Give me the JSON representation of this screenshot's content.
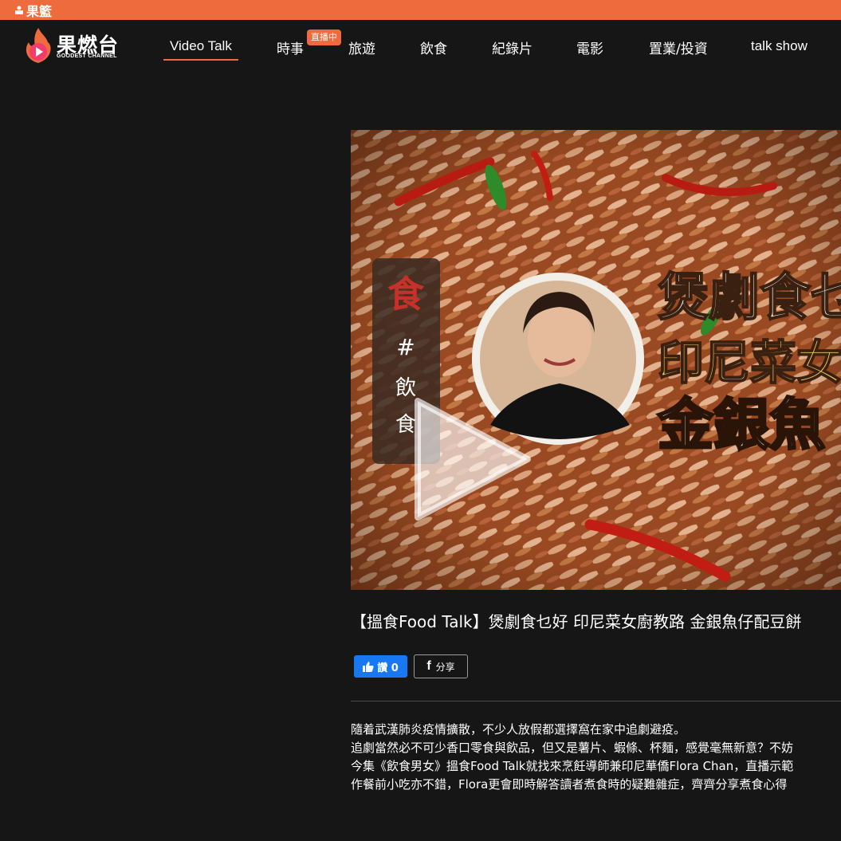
{
  "topbar": {
    "logo_text": "果籃"
  },
  "brand": {
    "name": "果燃台",
    "subtitle": "GOODEST CHANNEL"
  },
  "nav": {
    "items": [
      {
        "label": "Video Talk",
        "active": true
      },
      {
        "label": "時事"
      },
      {
        "label": "旅遊"
      },
      {
        "label": "飲食"
      },
      {
        "label": "紀錄片"
      },
      {
        "label": "電影"
      },
      {
        "label": "置業/投資"
      },
      {
        "label": "talk show"
      }
    ],
    "live_badge": "直播中"
  },
  "video": {
    "side_tag": {
      "icon_char": "食",
      "hash": "#",
      "line1": "飲",
      "line2": "食"
    },
    "overlay_line1": "煲劇食乜",
    "overlay_line2": "印尼菜女",
    "overlay_line3": "金銀魚"
  },
  "article": {
    "title": "【搵食Food Talk】煲劇食乜好 印尼菜女廚教路 金銀魚仔配豆餅",
    "like_label": "讚 0",
    "share_label": "分享",
    "paragraphs": [
      "隨着武漢肺炎疫情擴散，不少人放假都選擇窩在家中追劇避疫。",
      "追劇當然必不可少香口零食與飲品，但又是薯片、蝦條、杯麵，感覺毫無新意？不妨",
      "今集《飲食男女》搵食Food Talk就找來烹飪導師兼印尼華僑Flora Chan，直播示範",
      "作餐前小吃亦不錯，Flora更會即時解答讀者煮食時的疑難雜症，齊齊分享煮食心得"
    ]
  },
  "colors": {
    "accent": "#ee6b3d",
    "facebook": "#1877f2",
    "background": "#161616"
  }
}
